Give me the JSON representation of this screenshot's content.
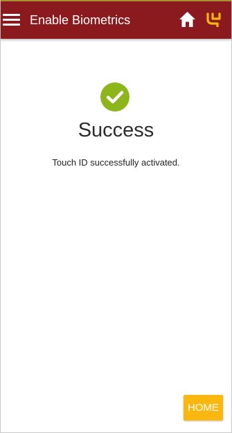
{
  "header": {
    "title": "Enable Biometrics",
    "menu_icon": "hamburger-menu-icon",
    "home_icon": "home-icon",
    "logo": "brand-logo",
    "background": "#8b1a1e"
  },
  "main": {
    "status_icon": "check-circle-icon",
    "status_color": "#8db61b",
    "heading": "Success",
    "message": "Touch ID successfully activated."
  },
  "footer": {
    "home_button_label": "HOME",
    "home_button_color": "#f9b70f"
  }
}
